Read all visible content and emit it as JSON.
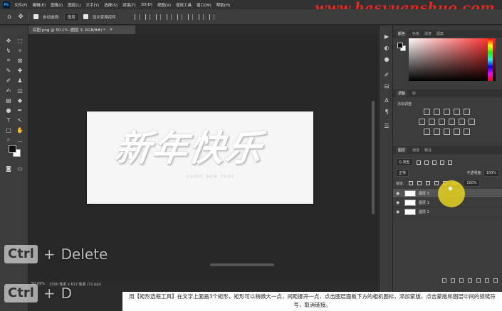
{
  "watermark": "www.hasyuanshuo.com",
  "menu": {
    "logo": "Ps",
    "items": [
      "文件(F)",
      "编辑(E)",
      "图像(I)",
      "图层(L)",
      "文字(Y)",
      "选择(S)",
      "滤镜(T)",
      "3D(D)",
      "视图(V)",
      "增效工具",
      "窗口(W)",
      "帮助(H)"
    ]
  },
  "options": {
    "auto_select_label": "自动选择:",
    "auto_select_value": "图层",
    "transform_label": "显示变换控件"
  },
  "document": {
    "tab_title": "底图.png @ 50.1% (图层 3, RGB/8#) *",
    "tab_close": "×",
    "canvas_text": "新年快乐",
    "canvas_subtext": "HAPPY NEW YEAR"
  },
  "status": {
    "zoom": "50.09%",
    "info": "1500 像素 x 617 像素 (72 ppi)"
  },
  "keys": {
    "row1": {
      "modifier": "Ctrl",
      "plus": "+",
      "key": "Delete"
    },
    "row2": {
      "modifier": "Ctrl",
      "plus": "+",
      "key": "D"
    }
  },
  "panels": {
    "color_tabs": [
      "颜色",
      "色板",
      "渐变",
      "图案"
    ],
    "adjust_tabs": [
      "调整",
      "库"
    ],
    "adjust_label": "添加调整",
    "layers_tabs": [
      "图层",
      "通道",
      "路径"
    ],
    "filter_kind": "Q 类型",
    "blend_mode": "正常",
    "opacity_label": "不透明度:",
    "opacity_value": "100%",
    "lock_label": "锁定:",
    "fill_label": "填充:",
    "fill_value": "100%",
    "layers": [
      {
        "name": "图层 3",
        "selected": true
      },
      {
        "name": "图层 1",
        "selected": false
      },
      {
        "name": "图层 2",
        "selected": false
      }
    ]
  },
  "caption": "用【矩形选框工具】在文字上面画3个矩形，矩形可以稍微大一点，间距挪开一点，点击图层面板下方的相机图标，添加蒙版，点击蒙版和图层中间的锁链符号，取消链接。",
  "colors": {
    "accent_yellow": "#e6d21e",
    "watermark_red": "#e32822"
  }
}
